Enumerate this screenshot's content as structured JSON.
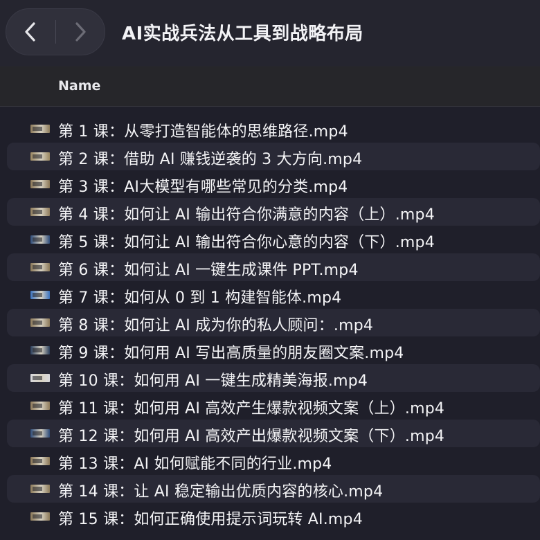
{
  "window": {
    "title": "AI实战兵法从工具到战略布局"
  },
  "nav": {
    "back_icon": "chevron-left-icon",
    "forward_icon": "chevron-right-icon"
  },
  "columns": {
    "name": "Name"
  },
  "files": [
    {
      "name": "第 1 课：从零打造智能体的思维路径.mp4",
      "thumb": "film-icon",
      "thumb_color": "#8c7a5a"
    },
    {
      "name": "第 2 课：借助 AI 赚钱逆袭的 3 大方向.mp4",
      "thumb": "film-icon",
      "thumb_color": "#9a8760"
    },
    {
      "name": "第 3 课：AI大模型有哪些常见的分类.mp4",
      "thumb": "film-icon",
      "thumb_color": "#8a7656"
    },
    {
      "name": "第 4 课：如何让 AI 输出符合你满意的内容（上）.mp4",
      "thumb": "film-icon",
      "thumb_color": "#8e7b5c"
    },
    {
      "name": "第 5 课：如何让 AI 输出符合你心意的内容（下）.mp4",
      "thumb": "film-icon",
      "thumb_color": "#2e4c7a"
    },
    {
      "name": "第 6 课：如何让 AI 一键生成课件 PPT.mp4",
      "thumb": "film-icon",
      "thumb_color": "#8a7858"
    },
    {
      "name": "第 7 课：如何从 0 到 1 构建智能体.mp4",
      "thumb": "film-icon",
      "thumb_color": "#3a72c0"
    },
    {
      "name": "第 8 课：如何让 AI 成为你的私人顾问：.mp4",
      "thumb": "film-icon",
      "thumb_color": "#8c795a"
    },
    {
      "name": "第 9 课：如何用 AI 写出高质量的朋友圈文案.mp4",
      "thumb": "film-icon",
      "thumb_color": "#2a3e5c"
    },
    {
      "name": "第 10 课：如何用 AI 一键生成精美海报.mp4",
      "thumb": "film-icon",
      "thumb_color": "#d8d8dc"
    },
    {
      "name": "第 11 课：如何用 AI 高效产生爆款视频文案（上）.mp4",
      "thumb": "film-icon",
      "thumb_color": "#8e7a5a"
    },
    {
      "name": "第 12 课：如何用 AI 高效产出爆款视频文案（下）.mp4",
      "thumb": "film-icon",
      "thumb_color": "#2e4c7a"
    },
    {
      "name": "第 13 课：AI 如何赋能不同的行业.mp4",
      "thumb": "film-icon",
      "thumb_color": "#8a7656"
    },
    {
      "name": "第 14 课：让 AI 稳定输出优质内容的核心.mp4",
      "thumb": "film-icon",
      "thumb_color": "#8c7a5a"
    },
    {
      "name": "第 15 课：如何正确使用提示词玩转 AI.mp4",
      "thumb": "film-icon",
      "thumb_color": "#8a7858"
    }
  ]
}
